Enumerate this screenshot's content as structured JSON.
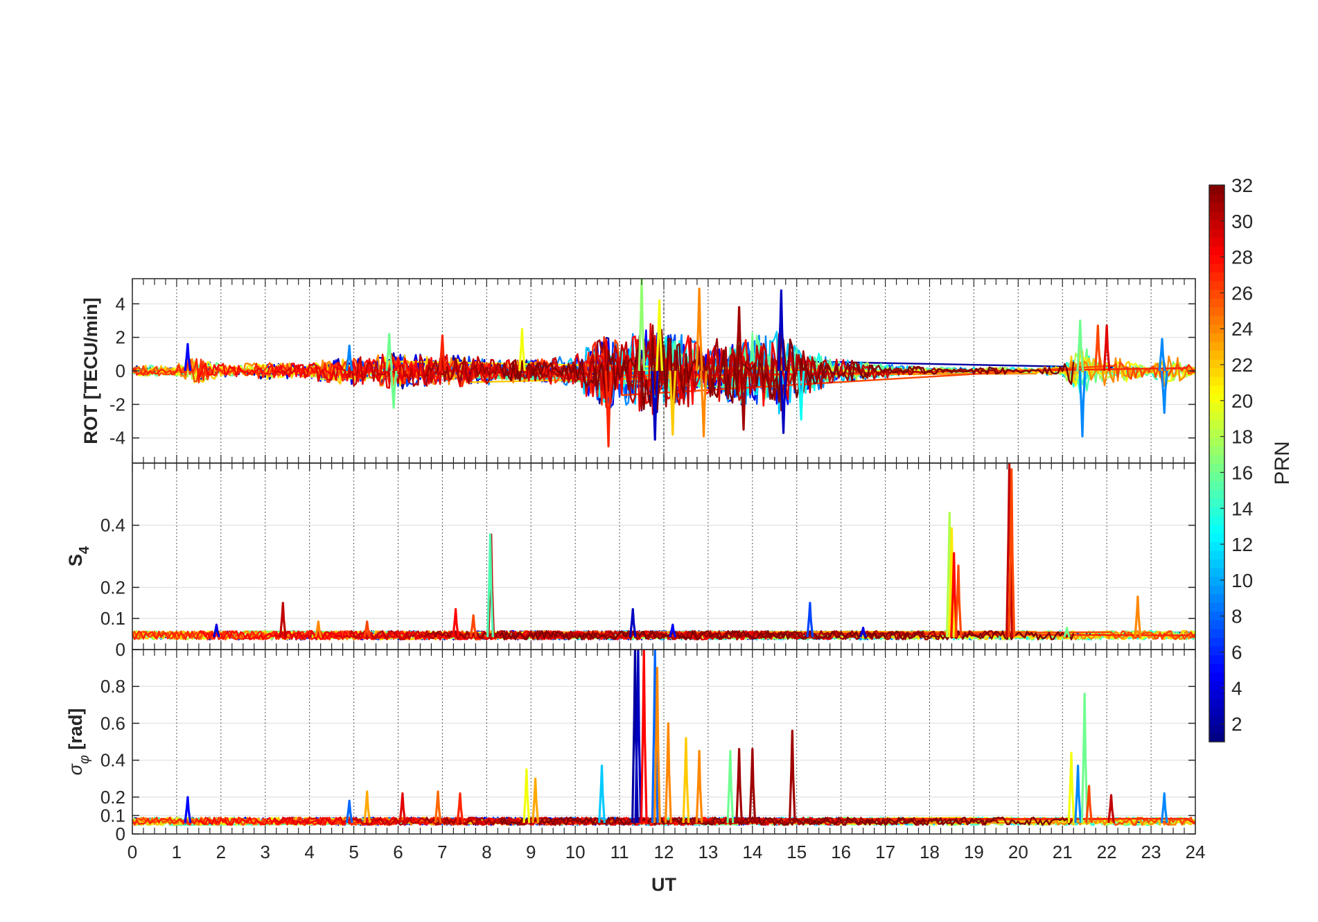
{
  "chart_data": [
    {
      "type": "line",
      "panel": "top",
      "ylabel": "ROT [TECU/min]",
      "xlim": [
        0,
        24
      ],
      "ylim": [
        -5.5,
        5.5
      ],
      "yticks": [
        -4,
        -2,
        0,
        2,
        4
      ],
      "ytick_labels": [
        "-4",
        "-2",
        "0",
        "2",
        "4"
      ],
      "grid": true,
      "vline_x": 12,
      "series_by": "PRN",
      "activity": [
        {
          "x": 0,
          "y": 0.5
        },
        {
          "x": 1,
          "y": 0.8
        },
        {
          "x": 1.3,
          "y": 1.6
        },
        {
          "x": 2,
          "y": 0.8
        },
        {
          "x": 3,
          "y": 0.9
        },
        {
          "x": 4,
          "y": 1.0
        },
        {
          "x": 5,
          "y": 1.6
        },
        {
          "x": 6,
          "y": 2.0
        },
        {
          "x": 7,
          "y": 2.0
        },
        {
          "x": 8,
          "y": 1.5
        },
        {
          "x": 9,
          "y": 1.2
        },
        {
          "x": 10,
          "y": 1.8
        },
        {
          "x": 10.7,
          "y": 4.5
        },
        {
          "x": 11,
          "y": 3.0
        },
        {
          "x": 11.5,
          "y": 5.5
        },
        {
          "x": 12,
          "y": 4.5
        },
        {
          "x": 12.5,
          "y": 4.0
        },
        {
          "x": 13,
          "y": 3.5
        },
        {
          "x": 13.7,
          "y": 3.8
        },
        {
          "x": 14.6,
          "y": 4.8
        },
        {
          "x": 15,
          "y": 3.0
        },
        {
          "x": 16,
          "y": 1.3
        },
        {
          "x": 17,
          "y": 0.8
        },
        {
          "x": 18,
          "y": 0.4
        },
        {
          "x": 19,
          "y": 0.4
        },
        {
          "x": 20,
          "y": 0.4
        },
        {
          "x": 21,
          "y": 0.5
        },
        {
          "x": 21.4,
          "y": 3.0
        },
        {
          "x": 22,
          "y": 1.8
        },
        {
          "x": 23,
          "y": 0.4
        },
        {
          "x": 23.3,
          "y": 2.4
        },
        {
          "x": 24,
          "y": 0.3
        }
      ],
      "spikes": [
        {
          "x": 1.25,
          "y": 1.6,
          "prn": 5
        },
        {
          "x": 4.9,
          "y": 1.5,
          "prn": 9
        },
        {
          "x": 5.8,
          "y": 2.2,
          "prn": 16
        },
        {
          "x": 5.9,
          "y": -2.2,
          "prn": 16
        },
        {
          "x": 7.0,
          "y": 2.1,
          "prn": 27
        },
        {
          "x": 8.8,
          "y": 2.5,
          "prn": 20
        },
        {
          "x": 10.75,
          "y": -4.5,
          "prn": 27
        },
        {
          "x": 11.5,
          "y": 5.5,
          "prn": 17
        },
        {
          "x": 11.9,
          "y": 4.2,
          "prn": 20
        },
        {
          "x": 12.2,
          "y": -3.8,
          "prn": 22
        },
        {
          "x": 12.8,
          "y": 4.9,
          "prn": 24
        },
        {
          "x": 12.9,
          "y": -3.9,
          "prn": 24
        },
        {
          "x": 11.8,
          "y": -4.1,
          "prn": 3
        },
        {
          "x": 13.7,
          "y": 3.8,
          "prn": 31
        },
        {
          "x": 13.8,
          "y": -3.5,
          "prn": 31
        },
        {
          "x": 14.65,
          "y": 4.8,
          "prn": 3
        },
        {
          "x": 14.7,
          "y": -3.7,
          "prn": 3
        },
        {
          "x": 15.1,
          "y": -2.9,
          "prn": 13
        },
        {
          "x": 21.4,
          "y": 3.0,
          "prn": 16
        },
        {
          "x": 21.45,
          "y": -3.9,
          "prn": 9
        },
        {
          "x": 21.8,
          "y": 2.7,
          "prn": 26
        },
        {
          "x": 22.0,
          "y": 2.7,
          "prn": 29
        },
        {
          "x": 23.25,
          "y": 1.9,
          "prn": 9
        },
        {
          "x": 23.3,
          "y": -2.5,
          "prn": 9
        }
      ]
    },
    {
      "type": "line",
      "panel": "middle",
      "ylabel": "S4",
      "ylabel_main": "S",
      "ylabel_sub": "4",
      "xlim": [
        0,
        24
      ],
      "ylim": [
        0,
        0.6
      ],
      "yticks": [
        0,
        0.1,
        0.2,
        0.4
      ],
      "ytick_labels": [
        "0",
        "0.1",
        "0.2",
        "0.4"
      ],
      "grid": true,
      "series_by": "PRN",
      "baseline": [
        0.02,
        0.06
      ],
      "spikes": [
        {
          "x": 1.9,
          "y": 0.08,
          "prn": 4
        },
        {
          "x": 3.4,
          "y": 0.15,
          "prn": 30
        },
        {
          "x": 4.2,
          "y": 0.09,
          "prn": 24
        },
        {
          "x": 5.3,
          "y": 0.09,
          "prn": 26
        },
        {
          "x": 7.3,
          "y": 0.13,
          "prn": 28
        },
        {
          "x": 7.7,
          "y": 0.11,
          "prn": 26
        },
        {
          "x": 8.1,
          "y": 0.37,
          "prn": 30
        },
        {
          "x": 8.08,
          "y": 0.37,
          "prn": 15
        },
        {
          "x": 11.3,
          "y": 0.13,
          "prn": 3
        },
        {
          "x": 12.2,
          "y": 0.08,
          "prn": 5
        },
        {
          "x": 15.3,
          "y": 0.15,
          "prn": 7
        },
        {
          "x": 16.5,
          "y": 0.07,
          "prn": 4
        },
        {
          "x": 18.45,
          "y": 0.44,
          "prn": 18
        },
        {
          "x": 18.5,
          "y": 0.39,
          "prn": 21
        },
        {
          "x": 18.55,
          "y": 0.31,
          "prn": 28
        },
        {
          "x": 18.65,
          "y": 0.27,
          "prn": 26
        },
        {
          "x": 19.8,
          "y": 0.6,
          "prn": 30
        },
        {
          "x": 19.85,
          "y": 0.58,
          "prn": 26
        },
        {
          "x": 22.7,
          "y": 0.17,
          "prn": 24
        },
        {
          "x": 21.1,
          "y": 0.07,
          "prn": 16
        }
      ]
    },
    {
      "type": "line",
      "panel": "bottom",
      "ylabel": "σφ [rad]",
      "ylabel_main": "σ",
      "ylabel_sub": "φ",
      "ylabel_suffix": " [rad]",
      "xlabel": "UT",
      "xlim": [
        0,
        24
      ],
      "ylim": [
        0,
        1.0
      ],
      "xticks": [
        0,
        1,
        2,
        3,
        4,
        5,
        6,
        7,
        8,
        9,
        10,
        11,
        12,
        13,
        14,
        15,
        16,
        17,
        18,
        19,
        20,
        21,
        22,
        23,
        24
      ],
      "xtick_labels": [
        "0",
        "1",
        "2",
        "3",
        "4",
        "5",
        "6",
        "7",
        "8",
        "9",
        "10",
        "11",
        "12",
        "13",
        "14",
        "15",
        "16",
        "17",
        "18",
        "19",
        "20",
        "21",
        "22",
        "23",
        "24"
      ],
      "yticks": [
        0,
        0.1,
        0.2,
        0.4,
        0.6,
        0.8
      ],
      "ytick_labels": [
        "0",
        "0.1",
        "0.2",
        "0.4",
        "0.6",
        "0.8"
      ],
      "grid": true,
      "series_by": "PRN",
      "baseline": [
        0.03,
        0.09
      ],
      "spikes": [
        {
          "x": 1.25,
          "y": 0.2,
          "prn": 5
        },
        {
          "x": 4.9,
          "y": 0.18,
          "prn": 8
        },
        {
          "x": 5.3,
          "y": 0.23,
          "prn": 23
        },
        {
          "x": 6.1,
          "y": 0.22,
          "prn": 29
        },
        {
          "x": 6.9,
          "y": 0.23,
          "prn": 25
        },
        {
          "x": 7.4,
          "y": 0.22,
          "prn": 27
        },
        {
          "x": 8.9,
          "y": 0.35,
          "prn": 20
        },
        {
          "x": 9.1,
          "y": 0.3,
          "prn": 23
        },
        {
          "x": 10.6,
          "y": 0.37,
          "prn": 11
        },
        {
          "x": 11.35,
          "y": 1.0,
          "prn": 2
        },
        {
          "x": 11.42,
          "y": 1.0,
          "prn": 3
        },
        {
          "x": 11.55,
          "y": 1.0,
          "prn": 28
        },
        {
          "x": 11.8,
          "y": 1.0,
          "prn": 8
        },
        {
          "x": 11.85,
          "y": 0.9,
          "prn": 24
        },
        {
          "x": 12.1,
          "y": 0.6,
          "prn": 24
        },
        {
          "x": 12.5,
          "y": 0.52,
          "prn": 22
        },
        {
          "x": 12.8,
          "y": 0.45,
          "prn": 24
        },
        {
          "x": 13.5,
          "y": 0.45,
          "prn": 16
        },
        {
          "x": 13.7,
          "y": 0.46,
          "prn": 31
        },
        {
          "x": 14.0,
          "y": 0.46,
          "prn": 31
        },
        {
          "x": 14.9,
          "y": 0.56,
          "prn": 31
        },
        {
          "x": 21.2,
          "y": 0.44,
          "prn": 20
        },
        {
          "x": 21.35,
          "y": 0.37,
          "prn": 9
        },
        {
          "x": 21.5,
          "y": 0.76,
          "prn": 16
        },
        {
          "x": 21.6,
          "y": 0.26,
          "prn": 26
        },
        {
          "x": 22.1,
          "y": 0.21,
          "prn": 30
        },
        {
          "x": 23.3,
          "y": 0.22,
          "prn": 9
        }
      ]
    }
  ],
  "colorbar": {
    "label": "PRN",
    "min": 1,
    "max": 32,
    "ticks": [
      2,
      4,
      6,
      8,
      10,
      12,
      14,
      16,
      18,
      20,
      22,
      24,
      26,
      28,
      30,
      32
    ],
    "tick_labels": [
      "2",
      "4",
      "6",
      "8",
      "10",
      "12",
      "14",
      "16",
      "18",
      "20",
      "22",
      "24",
      "26",
      "28",
      "30",
      "32"
    ],
    "colormap": "jet"
  },
  "colors": {
    "axis": "#262626",
    "grid": "#e6e6e6",
    "vgrid_dotted": "#555555",
    "background": "#ffffff"
  }
}
